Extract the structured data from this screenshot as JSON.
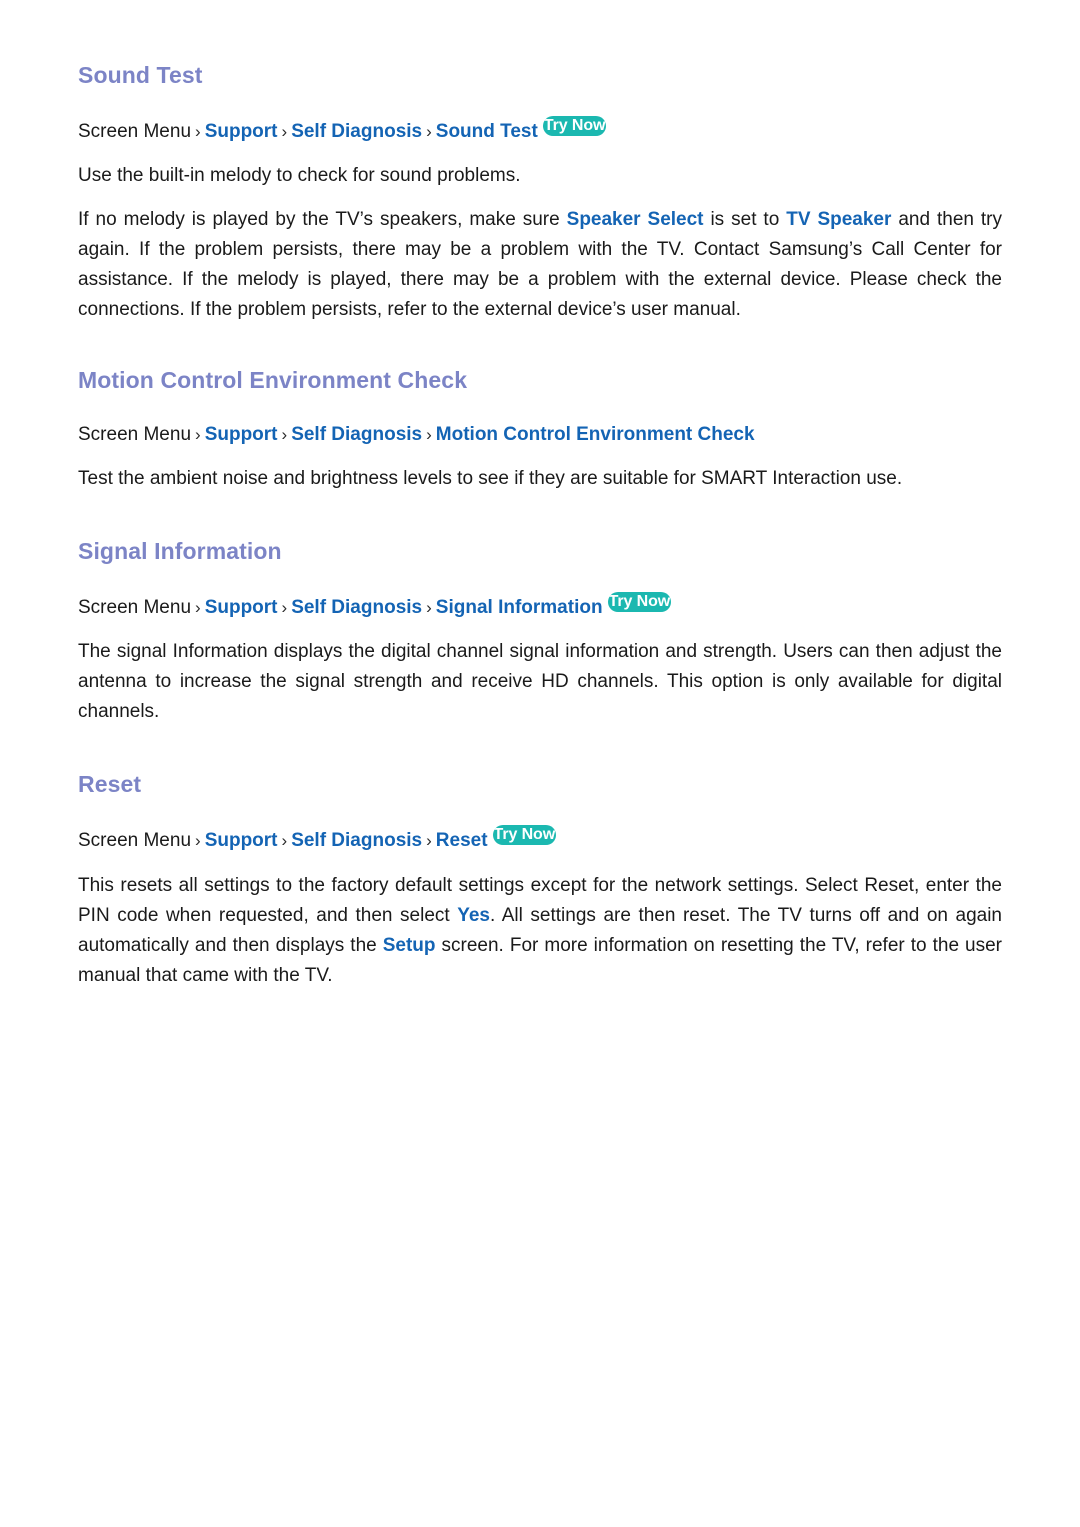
{
  "document": {
    "accent_heading_color": "#7c84c6",
    "link_color": "#1464b4",
    "badge_color": "#1bb8b0",
    "body_color": "#1a1a1a",
    "breadcrumb_separator": "›",
    "breadcrumb_root": "Screen Menu"
  },
  "sections": [
    {
      "id": "sound-test",
      "heading": "Sound Test",
      "breadcrumb": {
        "root": "Screen Menu",
        "links": [
          "Support",
          "Self Diagnosis",
          "Sound Test"
        ],
        "badge": "Try Now"
      },
      "paragraphs": [
        {
          "id": "p1",
          "text": "Use the built-in melody to check for sound problems."
        },
        {
          "id": "p2",
          "segments": [
            {
              "type": "plain",
              "text": "If no melody is played by the TV’s speakers, make sure "
            },
            {
              "type": "term",
              "text": "Speaker Select"
            },
            {
              "type": "plain",
              "text": " is set to "
            },
            {
              "type": "term",
              "text": "TV Speaker"
            },
            {
              "type": "plain",
              "text": " and then try again. If the problem persists, there may be a problem with the TV. Contact Samsung’s Call Center for assistance. If the melody is played, there may be a problem with the external device. Please check the connections. If the problem persists, refer to the external device’s user manual."
            }
          ]
        }
      ]
    },
    {
      "id": "motion-control",
      "heading": "Motion Control Environment Check",
      "breadcrumb": {
        "root": "Screen Menu",
        "links": [
          "Support",
          "Self Diagnosis",
          "Motion Control Environment Check"
        ],
        "badge": null
      },
      "paragraphs": [
        {
          "id": "p1",
          "text": "Test the ambient noise and brightness levels to see if they are suitable for SMART Interaction use."
        }
      ]
    },
    {
      "id": "signal-information",
      "heading": "Signal Information",
      "breadcrumb": {
        "root": "Screen Menu",
        "links": [
          "Support",
          "Self Diagnosis",
          "Signal Information"
        ],
        "badge": "Try Now"
      },
      "paragraphs": [
        {
          "id": "p1",
          "text": "The signal Information displays the digital channel signal information and strength. Users can then adjust the antenna to increase the signal strength and receive HD channels. This option is only available for digital channels."
        }
      ]
    },
    {
      "id": "reset",
      "heading": "Reset",
      "breadcrumb": {
        "root": "Screen Menu",
        "links": [
          "Support",
          "Self Diagnosis",
          "Reset"
        ],
        "badge": "Try Now"
      },
      "paragraphs": [
        {
          "id": "p1",
          "segments": [
            {
              "type": "plain",
              "text": "This resets all settings to the factory default settings except for the network settings. Select Reset, enter the PIN code when requested, and then select "
            },
            {
              "type": "term",
              "text": "Yes"
            },
            {
              "type": "plain",
              "text": ". All settings are then reset. The TV turns off and on again automatically and then displays the "
            },
            {
              "type": "term",
              "text": "Setup"
            },
            {
              "type": "plain",
              "text": " screen. For more information on resetting the TV, refer to the user manual that came with the TV."
            }
          ]
        }
      ]
    }
  ]
}
